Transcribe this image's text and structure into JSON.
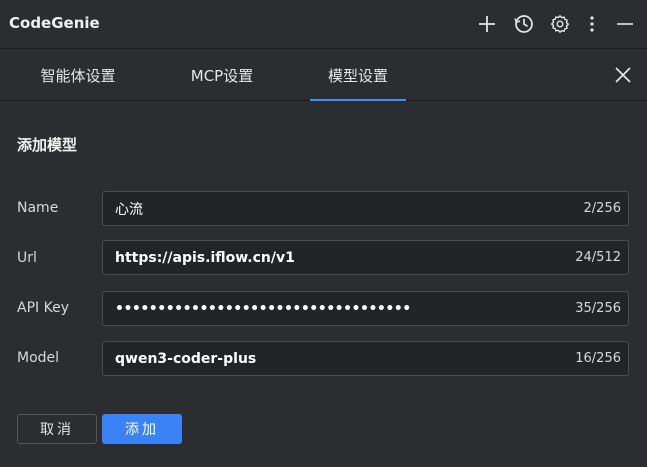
{
  "app": {
    "title": "CodeGenie"
  },
  "toolbar": {
    "icons": [
      "plus-icon",
      "history-icon",
      "gear-icon",
      "more-vertical-icon",
      "minimize-icon"
    ]
  },
  "tabs": [
    {
      "label": "智能体设置",
      "active": false
    },
    {
      "label": "MCP设置",
      "active": false
    },
    {
      "label": "模型设置",
      "active": true
    }
  ],
  "form": {
    "title": "添加模型",
    "fields": [
      {
        "label": "Name",
        "value": "心流",
        "counter": "2/256"
      },
      {
        "label": "Url",
        "value": "https://apis.iflow.cn/v1",
        "counter": "24/512"
      },
      {
        "label": "API Key",
        "value": "•••••••••••••••••••••••••••••••••••",
        "counter": "35/256"
      },
      {
        "label": "Model",
        "value": "qwen3-coder-plus",
        "counter": "16/256"
      }
    ],
    "cancel_label": "取消",
    "add_label": "添加"
  },
  "colors": {
    "background": "#2b2d31",
    "accent": "#3a8dff",
    "primary_button": "#3b82f6"
  }
}
